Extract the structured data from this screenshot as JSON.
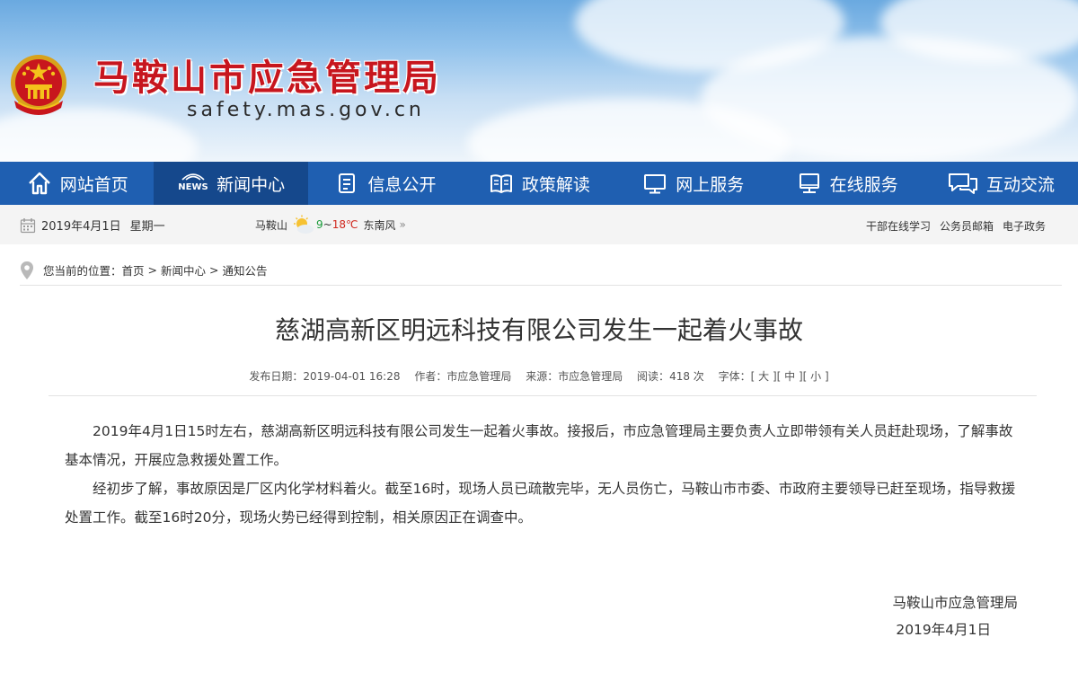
{
  "header": {
    "site_title": "马鞍山市应急管理局",
    "site_domain": "safety.mas.gov.cn",
    "title_color": "#c7161e"
  },
  "nav": {
    "color": "#1f5fb1",
    "active_color": "#15488c",
    "items": [
      {
        "label": "网站首页",
        "icon": "home-icon"
      },
      {
        "label": "新闻中心",
        "icon": "news-icon",
        "badge": "NEWS",
        "active": true
      },
      {
        "label": "信息公开",
        "icon": "document-icon"
      },
      {
        "label": "政策解读",
        "icon": "book-icon"
      },
      {
        "label": "网上服务",
        "icon": "monitor-icon"
      },
      {
        "label": "在线服务",
        "icon": "computer-icon"
      },
      {
        "label": "互动交流",
        "icon": "chat-icon"
      }
    ]
  },
  "infobar": {
    "date": "2019年4月1日",
    "weekday": "星期一",
    "city": "马鞍山",
    "temp_low": "9",
    "temp_sep": "~",
    "temp_high": "18℃",
    "wind": "东南风",
    "more": "»",
    "links": [
      "干部在线学习",
      "公务员邮箱",
      "电子政务"
    ]
  },
  "breadcrumb": {
    "prefix": "您当前的位置：",
    "items": [
      "首页",
      "新闻中心",
      "通知公告"
    ],
    "separator": ">"
  },
  "article": {
    "title": "慈湖高新区明远科技有限公司发生一起着火事故",
    "meta": {
      "publish_label": "发布日期：",
      "publish_date": "2019-04-01 16:28",
      "author_label": "作者：",
      "author": "市应急管理局",
      "source_label": "来源：",
      "source": "市应急管理局",
      "reads_label": "阅读：",
      "reads": "418",
      "reads_unit": "次",
      "font_label": "字体：",
      "font_large": "[ 大 ]",
      "font_medium": "[ 中 ]",
      "font_small": "[ 小 ]"
    },
    "paragraphs": [
      "2019年4月1日15时左右，慈湖高新区明远科技有限公司发生一起着火事故。接报后，市应急管理局主要负责人立即带领有关人员赶赴现场，了解事故基本情况，开展应急救援处置工作。",
      "经初步了解，事故原因是厂区内化学材料着火。截至16时，现场人员已疏散完毕，无人员伤亡，马鞍山市市委、市政府主要领导已赶至现场，指导救援处置工作。截至16时20分，现场火势已经得到控制，相关原因正在调查中。"
    ],
    "signature": "马鞍山市应急管理局",
    "sign_date": "2019年4月1日"
  }
}
